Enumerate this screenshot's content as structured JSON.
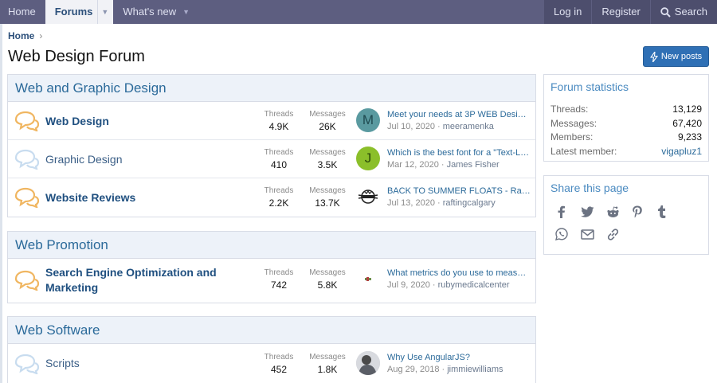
{
  "nav": {
    "home": "Home",
    "forums": "Forums",
    "whats_new": "What's new",
    "login": "Log in",
    "register": "Register",
    "search": "Search"
  },
  "breadcrumb": {
    "home": "Home"
  },
  "page": {
    "title": "Web Design Forum",
    "new_posts": "New posts"
  },
  "labels": {
    "threads": "Threads",
    "messages": "Messages"
  },
  "categories": [
    {
      "title": "Web and Graphic Design",
      "nodes": [
        {
          "title": "Web Design",
          "unread": true,
          "threads": "4.9K",
          "messages": "26K",
          "avatar_letter": "M",
          "avatar_color": "#5a9aa0",
          "last_title": "Meet your needs at 3P WEB Design…",
          "last_date": "Jul 10, 2020",
          "last_user": "meeramenka"
        },
        {
          "title": "Graphic Design",
          "unread": false,
          "threads": "410",
          "messages": "3.5K",
          "avatar_letter": "J",
          "avatar_color": "#8bbf2a",
          "last_title": "Which is the best font for a \"Text-L…",
          "last_date": "Mar 12, 2020",
          "last_user": "James Fisher"
        },
        {
          "title": "Website Reviews",
          "unread": true,
          "threads": "2.2K",
          "messages": "13.7K",
          "avatar_letter": "",
          "avatar_color": "#ffffff",
          "last_title": "BACK TO SUMMER FLOATS - Raftin…",
          "last_date": "Jul 13, 2020",
          "last_user": "raftingcalgary"
        }
      ]
    },
    {
      "title": "Web Promotion",
      "nodes": [
        {
          "title": "Search Engine Optimization and Marketing",
          "unread": true,
          "threads": "742",
          "messages": "5.8K",
          "avatar_letter": "",
          "avatar_color": "#ffffff",
          "last_title": "What metrics do you use to measur…",
          "last_date": "Jul 9, 2020",
          "last_user": "rubymedicalcenter"
        }
      ]
    },
    {
      "title": "Web Software",
      "nodes": [
        {
          "title": "Scripts",
          "unread": false,
          "threads": "452",
          "messages": "1.8K",
          "avatar_letter": "",
          "avatar_color": "#9aa0a8",
          "last_title": "Why Use AngularJS?",
          "last_date": "Aug 29, 2018",
          "last_user": "jimmiewilliams"
        }
      ]
    }
  ],
  "sidebar": {
    "stats_title": "Forum statistics",
    "stats": [
      {
        "k": "Threads:",
        "v": "13,129"
      },
      {
        "k": "Messages:",
        "v": "67,420"
      },
      {
        "k": "Members:",
        "v": "9,233"
      },
      {
        "k": "Latest member:",
        "v": "vigapluz1"
      }
    ],
    "share_title": "Share this page",
    "share_icons": [
      "facebook-icon",
      "twitter-icon",
      "reddit-icon",
      "pinterest-icon",
      "tumblr-icon",
      "whatsapp-icon",
      "email-icon",
      "link-icon"
    ]
  },
  "colors": {
    "nav_bg": "#5d5e80",
    "accent": "#2f70b5",
    "unread_icon": "#f0b661",
    "read_icon": "#c8dcef"
  }
}
